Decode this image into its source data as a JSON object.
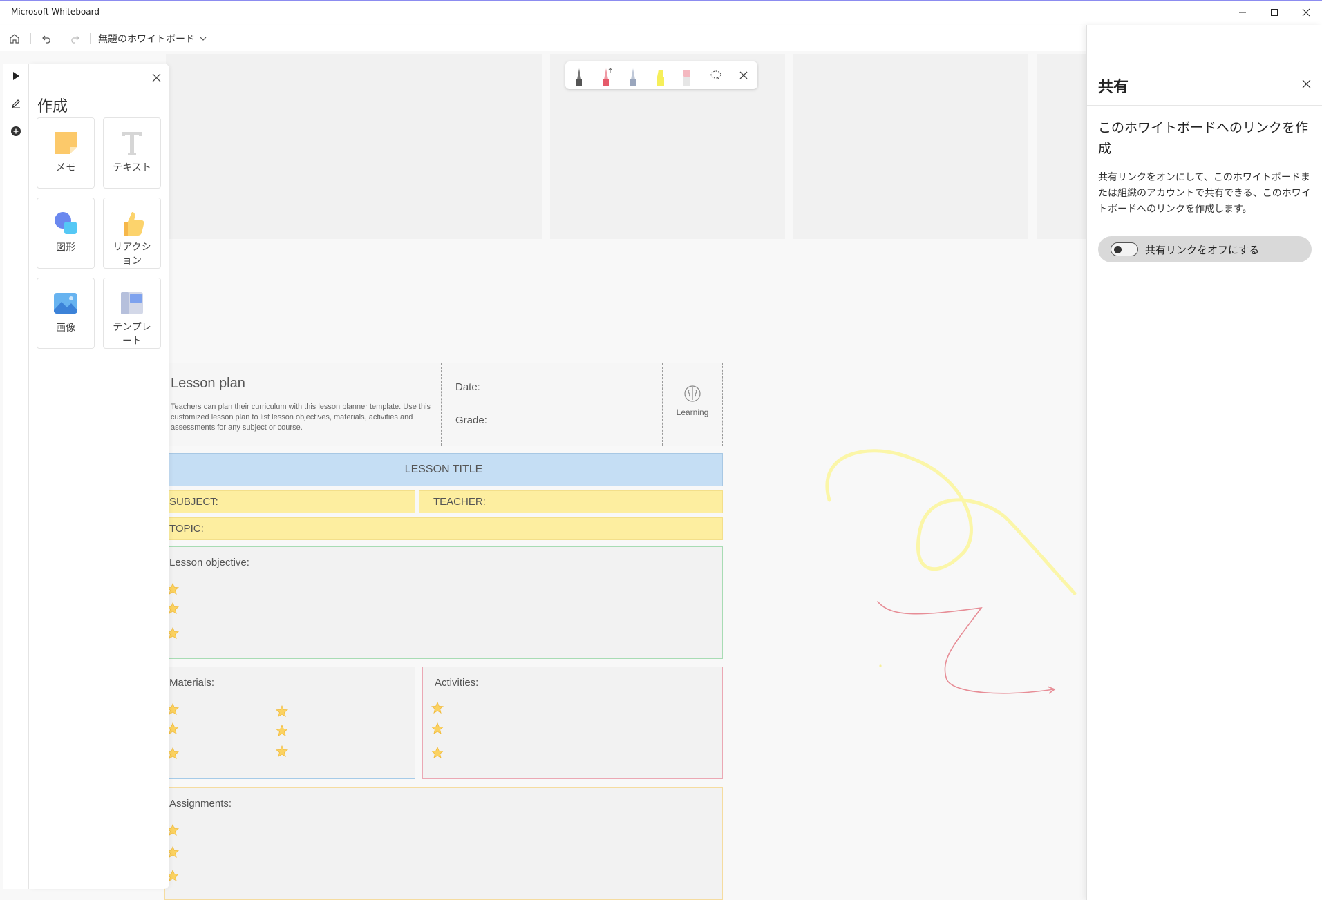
{
  "app": {
    "title": "Microsoft Whiteboard"
  },
  "window_controls": {
    "minimize": "minimize-icon",
    "maximize": "maximize-icon",
    "close": "close-icon"
  },
  "toolbar": {
    "board_name": "無題のホワイトボード"
  },
  "create_panel": {
    "title": "作成",
    "tiles": [
      {
        "label": "メモ",
        "icon": "sticky-note-icon"
      },
      {
        "label": "テキスト",
        "icon": "text-icon"
      },
      {
        "label": "図形",
        "icon": "shapes-icon"
      },
      {
        "label": "リアクション",
        "icon": "thumbs-up-icon"
      },
      {
        "label": "画像",
        "icon": "image-icon"
      },
      {
        "label": "テンプレート",
        "icon": "template-icon"
      }
    ]
  },
  "pen_tray": {
    "pens": [
      {
        "name": "black-pen",
        "color": "#555555"
      },
      {
        "name": "red-pen",
        "color": "#e55a6a"
      },
      {
        "name": "blue-pen",
        "color": "#9aa6bd"
      },
      {
        "name": "yellow-highlighter",
        "color": "#f6ef5a"
      },
      {
        "name": "eraser",
        "color": "#f4b8c0"
      }
    ]
  },
  "lesson_plan": {
    "title": "Lesson plan",
    "description": "Teachers can plan their curriculum with this lesson planner template. Use this customized lesson plan to list lesson objectives, materials, activities and assessments for any subject or course.",
    "date_label": "Date:",
    "grade_label": "Grade:",
    "learning_label": "Learning",
    "lesson_title": "LESSON TITLE",
    "subject_label": "SUBJECT:",
    "teacher_label": "TEACHER:",
    "topic_label": "TOPIC:",
    "objective_label": "Lesson objective:",
    "materials_label": "Materials:",
    "activities_label": "Activities:",
    "assignments_label": "Assignments:",
    "colors": {
      "title_band": "#c5def4",
      "yellow_band": "#fdeea0",
      "objective_border": "#a8dcb4",
      "materials_border": "#a6cbe8",
      "activities_border": "#eba8b4",
      "assignments_border": "#f5dca0"
    }
  },
  "share_panel": {
    "title": "共有",
    "heading": "このホワイトボードへのリンクを作成",
    "description": "共有リンクをオンにして、このホワイトボードまたは組織のアカウントで共有できる、このホワイトボードへのリンクを作成します。",
    "toggle_label": "共有リンクをオフにする",
    "toggle_state": "off"
  }
}
